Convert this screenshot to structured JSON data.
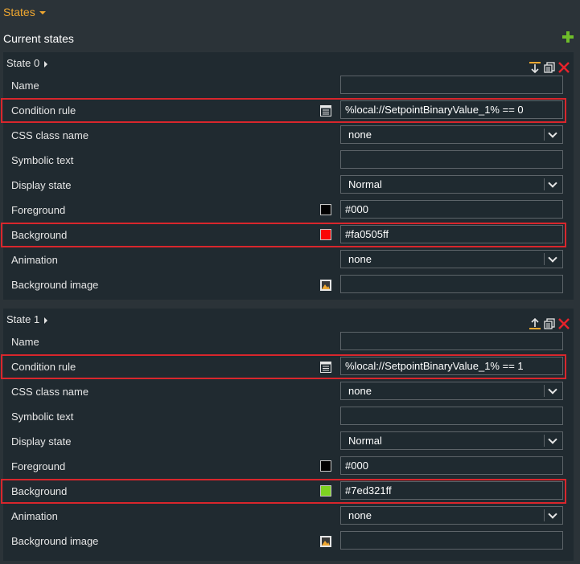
{
  "header": {
    "title": "States"
  },
  "current_title": "Current states",
  "labels": {
    "name": "Name",
    "condition": "Condition rule",
    "css": "CSS class name",
    "symbolic": "Symbolic text",
    "display": "Display state",
    "foreground": "Foreground",
    "background": "Background",
    "animation": "Animation",
    "bgimage": "Background image"
  },
  "states": [
    {
      "title": "State 0",
      "name": "",
      "condition": "%local://SetpointBinaryValue_1% == 0",
      "css": "none",
      "symbolic": "",
      "display": "Normal",
      "foreground": "#000",
      "foreground_color": "#000000",
      "background": "#fa0505ff",
      "background_color": "#fa0505",
      "animation": "none",
      "bgimage": ""
    },
    {
      "title": "State 1",
      "name": "",
      "condition": "%local://SetpointBinaryValue_1% == 1",
      "css": "none",
      "symbolic": "",
      "display": "Normal",
      "foreground": "#000",
      "foreground_color": "#000000",
      "background": "#7ed321ff",
      "background_color": "#7ed321",
      "animation": "none",
      "bgimage": ""
    }
  ],
  "colors": {
    "accent": "#f0a830",
    "add": "#6ebd2a",
    "delete": "#e8222b",
    "highlight": "#d9262c"
  }
}
